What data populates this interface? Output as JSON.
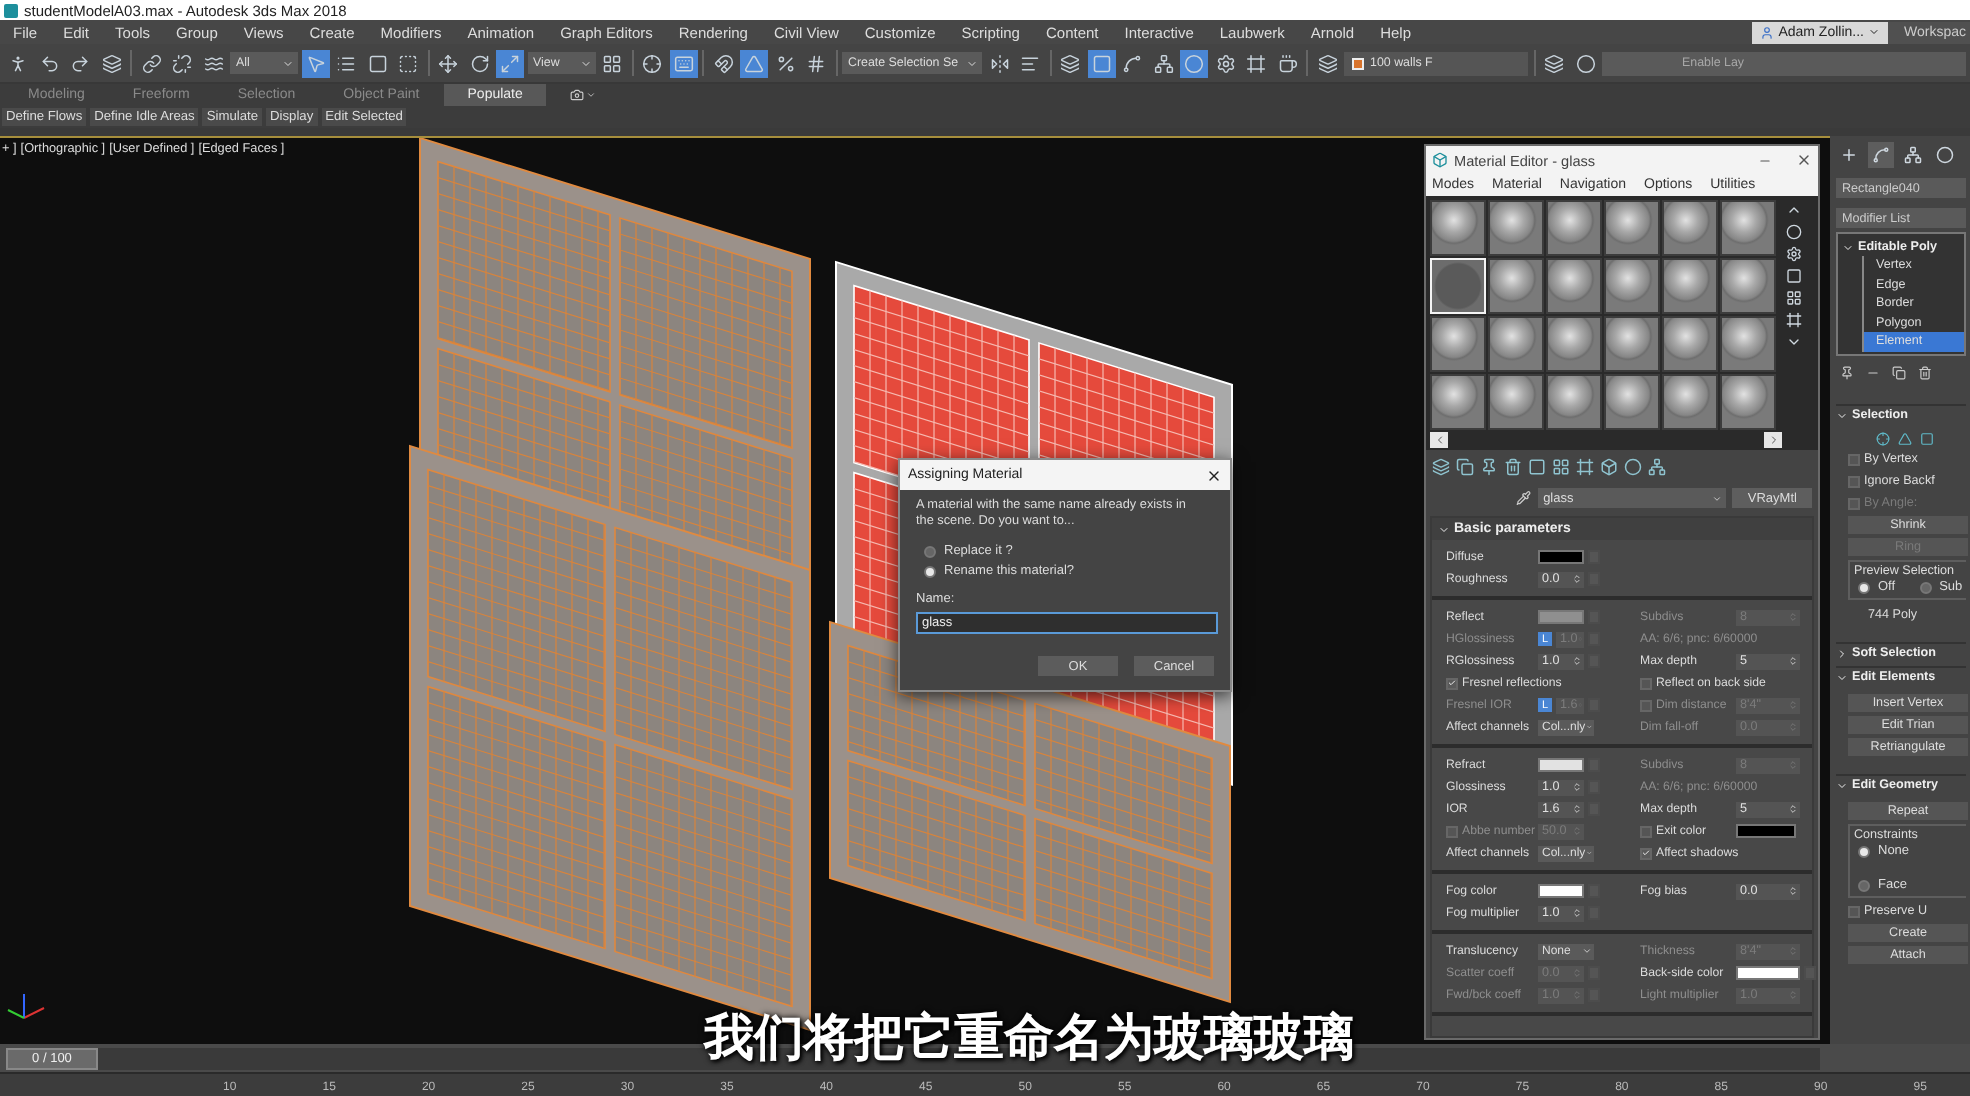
{
  "window": {
    "title": "studentModelA03.max - Autodesk 3ds Max 2018"
  },
  "menu_bar": {
    "items": [
      "File",
      "Edit",
      "Tools",
      "Group",
      "Views",
      "Create",
      "Modifiers",
      "Animation",
      "Graph Editors",
      "Rendering",
      "Civil View",
      "Customize",
      "Scripting",
      "Content",
      "Interactive",
      "Laubwerk",
      "Arnold",
      "Help"
    ],
    "user": "Adam Zollin...",
    "workspace": "Workspac"
  },
  "toolbar": [
    {
      "kind": "figure",
      "active": false
    },
    {
      "kind": "undo",
      "active": false
    },
    {
      "kind": "redo",
      "active": false
    },
    {
      "kind": "stack",
      "active": false
    },
    {
      "kind": "sep"
    },
    {
      "kind": "link",
      "active": false
    },
    {
      "kind": "unlink",
      "active": false
    },
    {
      "kind": "wave",
      "active": false
    },
    {
      "kind": "dropdown",
      "value": "All"
    },
    {
      "kind": "select",
      "active": true
    },
    {
      "kind": "list",
      "active": false
    },
    {
      "kind": "region",
      "active": false
    },
    {
      "kind": "crossing",
      "active": false
    },
    {
      "kind": "sep"
    },
    {
      "kind": "move",
      "active": false
    },
    {
      "kind": "rotate",
      "active": false
    },
    {
      "kind": "scale",
      "active": true
    },
    {
      "kind": "dropdown",
      "value": "View"
    },
    {
      "kind": "pivot",
      "active": false
    },
    {
      "kind": "sep"
    },
    {
      "kind": "crosshair",
      "active": false
    },
    {
      "kind": "keyboard",
      "active": true
    },
    {
      "kind": "sep"
    },
    {
      "kind": "snap",
      "active": false
    },
    {
      "kind": "angle",
      "active": true
    },
    {
      "kind": "percent",
      "active": false
    },
    {
      "kind": "spinner",
      "active": false
    },
    {
      "kind": "sep"
    },
    {
      "kind": "dropdown",
      "value": "Create Selection Se"
    },
    {
      "kind": "mirror",
      "active": false
    },
    {
      "kind": "align",
      "active": false
    },
    {
      "kind": "sep"
    },
    {
      "kind": "layers",
      "active": false
    },
    {
      "kind": "square",
      "active": true
    },
    {
      "kind": "curve",
      "active": false
    },
    {
      "kind": "schematic",
      "active": false
    },
    {
      "kind": "material",
      "active": true
    },
    {
      "kind": "render_setup",
      "active": false
    },
    {
      "kind": "frame",
      "active": false
    },
    {
      "kind": "teapot",
      "active": false
    },
    {
      "kind": "sep"
    },
    {
      "kind": "layers",
      "active": false
    },
    {
      "kind": "layer",
      "value": "100  walls F"
    },
    {
      "kind": "sep"
    },
    {
      "kind": "stack",
      "active": false
    },
    {
      "kind": "sphere",
      "active": false
    },
    {
      "kind": "field",
      "value": "Enable Lay"
    }
  ],
  "ribbon": {
    "tabs": [
      {
        "label": "Modeling",
        "selected": false
      },
      {
        "label": "Freeform",
        "selected": false
      },
      {
        "label": "Selection",
        "selected": false
      },
      {
        "label": "Object Paint",
        "selected": false
      },
      {
        "label": "Populate",
        "selected": true
      }
    ],
    "items": [
      "Define Flows",
      "Define Idle Areas",
      "Simulate",
      "Display",
      "Edit Selected"
    ]
  },
  "viewport": {
    "labels": [
      "+ ]",
      "[Orthographic ]",
      "[User Defined ]",
      "[Edged Faces ]"
    ]
  },
  "material_editor": {
    "title": "Material Editor - glass",
    "menus": [
      "Modes",
      "Material",
      "Navigation",
      "Options",
      "Utilities"
    ],
    "slots": [
      {
        "selected": false
      },
      {
        "selected": false
      },
      {
        "selected": false
      },
      {
        "selected": false
      },
      {
        "selected": false
      },
      {
        "selected": false
      },
      {
        "selected": true
      },
      {
        "selected": false
      },
      {
        "selected": false
      },
      {
        "selected": false
      },
      {
        "selected": false
      },
      {
        "selected": false
      },
      {
        "selected": false
      },
      {
        "selected": false
      },
      {
        "selected": false
      },
      {
        "selected": false
      },
      {
        "selected": false
      },
      {
        "selected": false
      },
      {
        "selected": false
      },
      {
        "selected": false
      },
      {
        "selected": false
      },
      {
        "selected": false
      },
      {
        "selected": false
      },
      {
        "selected": false
      }
    ],
    "material_name": "glass",
    "material_type": "VRayMtl",
    "rollout": {
      "title": "Basic parameters",
      "sections": [
        {
          "rows": [
            {
              "left": {
                "kind": "swatch",
                "label": "Diffuse",
                "color": "#000000",
                "disabled": false
              }
            },
            {
              "left": {
                "kind": "spinner",
                "label": "Roughness",
                "value": "0.0",
                "disabled": false
              }
            }
          ]
        },
        {
          "rows": [
            {
              "left": {
                "kind": "swatch",
                "label": "Reflect",
                "color": "#8f8f8f",
                "disabled": false
              },
              "right": {
                "kind": "spinner",
                "label": "Subdivs",
                "value": "8",
                "disabled": true
              }
            },
            {
              "left": {
                "kind": "spinner",
                "label": "HGlossiness",
                "lock": "L",
                "value": "1.0",
                "disabled": true
              },
              "right": {
                "kind": "text",
                "label": "AA: 6/6; pnc: 6/60000",
                "disabled": true
              }
            },
            {
              "left": {
                "kind": "spinner",
                "label": "RGlossiness",
                "value": "1.0",
                "disabled": false
              },
              "right": {
                "kind": "spinner",
                "label": "Max depth",
                "value": "5",
                "disabled": false
              }
            },
            {
              "left": {
                "kind": "checkbox",
                "label": "Fresnel reflections",
                "checked": true,
                "disabled": false
              },
              "right": {
                "kind": "checkbox",
                "label": "Reflect on back side",
                "checked": false,
                "disabled": false
              }
            },
            {
              "left": {
                "kind": "spinner",
                "label": "Fresnel IOR",
                "lock": "L",
                "value": "1.6",
                "disabled": true
              },
              "right": {
                "kind": "checkbox",
                "label": "Dim distance",
                "checked": false,
                "value": "8'4\"",
                "disabled": true
              }
            },
            {
              "left": {
                "kind": "dropdown",
                "label": "Affect channels",
                "value": "Col...nly",
                "disabled": false
              },
              "right": {
                "kind": "spinner",
                "label": "Dim fall-off",
                "value": "0.0",
                "disabled": true
              }
            }
          ]
        },
        {
          "rows": [
            {
              "left": {
                "kind": "swatch",
                "label": "Refract",
                "color": "#e2e2e2",
                "disabled": false
              },
              "right": {
                "kind": "spinner",
                "label": "Subdivs",
                "value": "8",
                "disabled": true
              }
            },
            {
              "left": {
                "kind": "spinner",
                "label": "Glossiness",
                "value": "1.0",
                "disabled": false
              },
              "right": {
                "kind": "text",
                "label": "AA: 6/6; pnc: 6/60000",
                "disabled": true
              }
            },
            {
              "left": {
                "kind": "spinner",
                "label": "IOR",
                "value": "1.6",
                "disabled": false
              },
              "right": {
                "kind": "spinner",
                "label": "Max depth",
                "value": "5",
                "disabled": false
              }
            },
            {
              "left": {
                "kind": "checkbox",
                "label": "Abbe number",
                "checked": false,
                "value": "50.0",
                "disabled": true
              },
              "right": {
                "kind": "checkbox",
                "label": "Exit color",
                "checked": false,
                "color": "#000000",
                "disabled": false
              }
            },
            {
              "left": {
                "kind": "dropdown",
                "label": "Affect channels",
                "value": "Col...nly",
                "disabled": false
              },
              "right": {
                "kind": "checkbox",
                "label": "Affect shadows",
                "checked": true,
                "disabled": false
              }
            }
          ]
        },
        {
          "rows": [
            {
              "left": {
                "kind": "swatch",
                "label": "Fog color",
                "color": "#ffffff",
                "disabled": false
              },
              "right": {
                "kind": "spinner",
                "label": "Fog bias",
                "value": "0.0",
                "disabled": false
              }
            },
            {
              "left": {
                "kind": "spinner",
                "label": "Fog multiplier",
                "value": "1.0",
                "disabled": false
              }
            }
          ]
        },
        {
          "rows": [
            {
              "left": {
                "kind": "dropdown",
                "label": "Translucency",
                "value": "None",
                "disabled": false
              },
              "right": {
                "kind": "spinner",
                "label": "Thickness",
                "value": "8'4\"",
                "disabled": true
              }
            },
            {
              "left": {
                "kind": "spinner",
                "label": "Scatter coeff",
                "value": "0.0",
                "disabled": true
              },
              "right": {
                "kind": "swatch",
                "label": "Back-side color",
                "color": "#ffffff",
                "disabled": false
              }
            },
            {
              "left": {
                "kind": "spinner",
                "label": "Fwd/bck coeff",
                "value": "1.0",
                "disabled": true
              },
              "right": {
                "kind": "spinner",
                "label": "Light multiplier",
                "value": "1.0",
                "disabled": true
              }
            }
          ]
        }
      ]
    }
  },
  "dialog": {
    "title": "Assigning Material",
    "message": "A material with the same name already exists in the scene. Do you want to...",
    "options": [
      {
        "label": "Replace it ?",
        "selected": false
      },
      {
        "label": "Rename this material?",
        "selected": true
      }
    ],
    "name_label": "Name:",
    "name_value": "glass",
    "buttons": [
      "OK",
      "Cancel"
    ]
  },
  "command_panel": {
    "tabs": [
      {
        "kind": "create",
        "selected": false
      },
      {
        "kind": "modify",
        "selected": true
      },
      {
        "kind": "hierarchy",
        "selected": false
      },
      {
        "kind": "motion",
        "selected": false
      }
    ],
    "object_name": "Rectangle040",
    "modifier_list": "Modifier List",
    "stack": [
      {
        "label": "Editable Poly",
        "expanded": true,
        "children": [
          {
            "label": "Vertex",
            "selected": false
          },
          {
            "label": "Edge",
            "selected": false
          },
          {
            "label": "Border",
            "selected": false
          },
          {
            "label": "Polygon",
            "selected": false
          },
          {
            "label": "Element",
            "selected": true
          }
        ]
      }
    ],
    "rollouts": [
      {
        "title": "Selection",
        "expanded": true,
        "items": [
          {
            "kind": "icons"
          },
          {
            "kind": "checkbox",
            "label": "By Vertex",
            "checked": false,
            "disabled": false
          },
          {
            "kind": "checkbox",
            "label": "Ignore Backf",
            "checked": false,
            "disabled": false
          },
          {
            "kind": "checkbox",
            "label": "By Angle:",
            "checked": false,
            "disabled": true
          },
          {
            "kind": "button",
            "label": "Shrink",
            "disabled": false
          },
          {
            "kind": "button",
            "label": "Ring",
            "disabled": true
          },
          {
            "kind": "group",
            "label": "Preview Selection",
            "options": [
              {
                "label": "Off",
                "selected": true
              },
              {
                "label": "Sub",
                "selected": false
              }
            ]
          },
          {
            "kind": "text",
            "label": "744 Poly"
          }
        ]
      },
      {
        "title": "Soft Selection",
        "expanded": false
      },
      {
        "title": "Edit Elements",
        "expanded": true,
        "items": [
          {
            "kind": "button",
            "label": "Insert Vertex",
            "disabled": false
          },
          {
            "kind": "button",
            "label": "Edit Trian",
            "disabled": false
          },
          {
            "kind": "button",
            "label": "Retriangulate",
            "disabled": false
          }
        ]
      },
      {
        "title": "Edit Geometry",
        "expanded": true,
        "items": [
          {
            "kind": "button",
            "label": "Repeat",
            "disabled": false
          },
          {
            "kind": "group",
            "label": "Constraints",
            "options": [
              {
                "label": "None",
                "selected": true
              },
              {
                "label": "Face",
                "selected": false
              }
            ]
          },
          {
            "kind": "checkbox",
            "label": "Preserve U",
            "checked": false,
            "disabled": false
          },
          {
            "kind": "button",
            "label": "Create",
            "disabled": false
          },
          {
            "kind": "button",
            "label": "Attach",
            "disabled": false
          }
        ]
      }
    ]
  },
  "timeline": {
    "frame": "0 / 100",
    "level": 0,
    "ticks": [
      "10",
      "15",
      "20",
      "25",
      "30",
      "35",
      "40",
      "45",
      "50",
      "55",
      "60",
      "65",
      "70",
      "75",
      "80",
      "85",
      "90",
      "95"
    ]
  },
  "subtitle": "我们将把它重命名为玻璃玻璃"
}
